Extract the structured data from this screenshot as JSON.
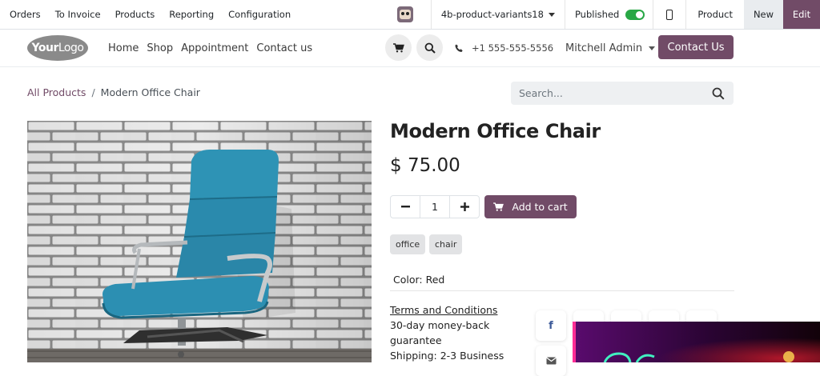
{
  "admin_bar": {
    "menu": [
      "Orders",
      "To Invoice",
      "Products",
      "Reporting",
      "Configuration"
    ],
    "database": "4b-product-variants18",
    "published_label": "Published",
    "published": true,
    "product_label": "Product",
    "new_label": "New",
    "edit_label": "Edit"
  },
  "header": {
    "logo_bold": "Your",
    "logo_thin": "Logo",
    "nav": [
      "Home",
      "Shop",
      "Appointment",
      "Contact us"
    ],
    "phone": "+1 555-555-5556",
    "user": "Mitchell Admin",
    "contact_button": "Contact Us"
  },
  "breadcrumb": {
    "parent": "All Products",
    "separator": "/",
    "current": "Modern Office Chair"
  },
  "search": {
    "placeholder": "Search..."
  },
  "product": {
    "name": "Modern Office Chair",
    "price": "$ 75.00",
    "quantity": "1",
    "add_to_cart": "Add to cart",
    "tags": [
      "office",
      "chair"
    ],
    "color_label": "Color: Red",
    "terms_link": "Terms and Conditions",
    "terms_line1": "30-day money-back",
    "terms_line2": "guarantee",
    "terms_line3": "Shipping: 2-3 Business"
  },
  "colors": {
    "brand": "#714b67",
    "toggle_on": "#28a745"
  },
  "icons": [
    "cart-icon",
    "search-icon",
    "phone-icon",
    "mobile-preview-icon",
    "minus-icon",
    "plus-icon",
    "facebook-icon",
    "email-icon"
  ]
}
